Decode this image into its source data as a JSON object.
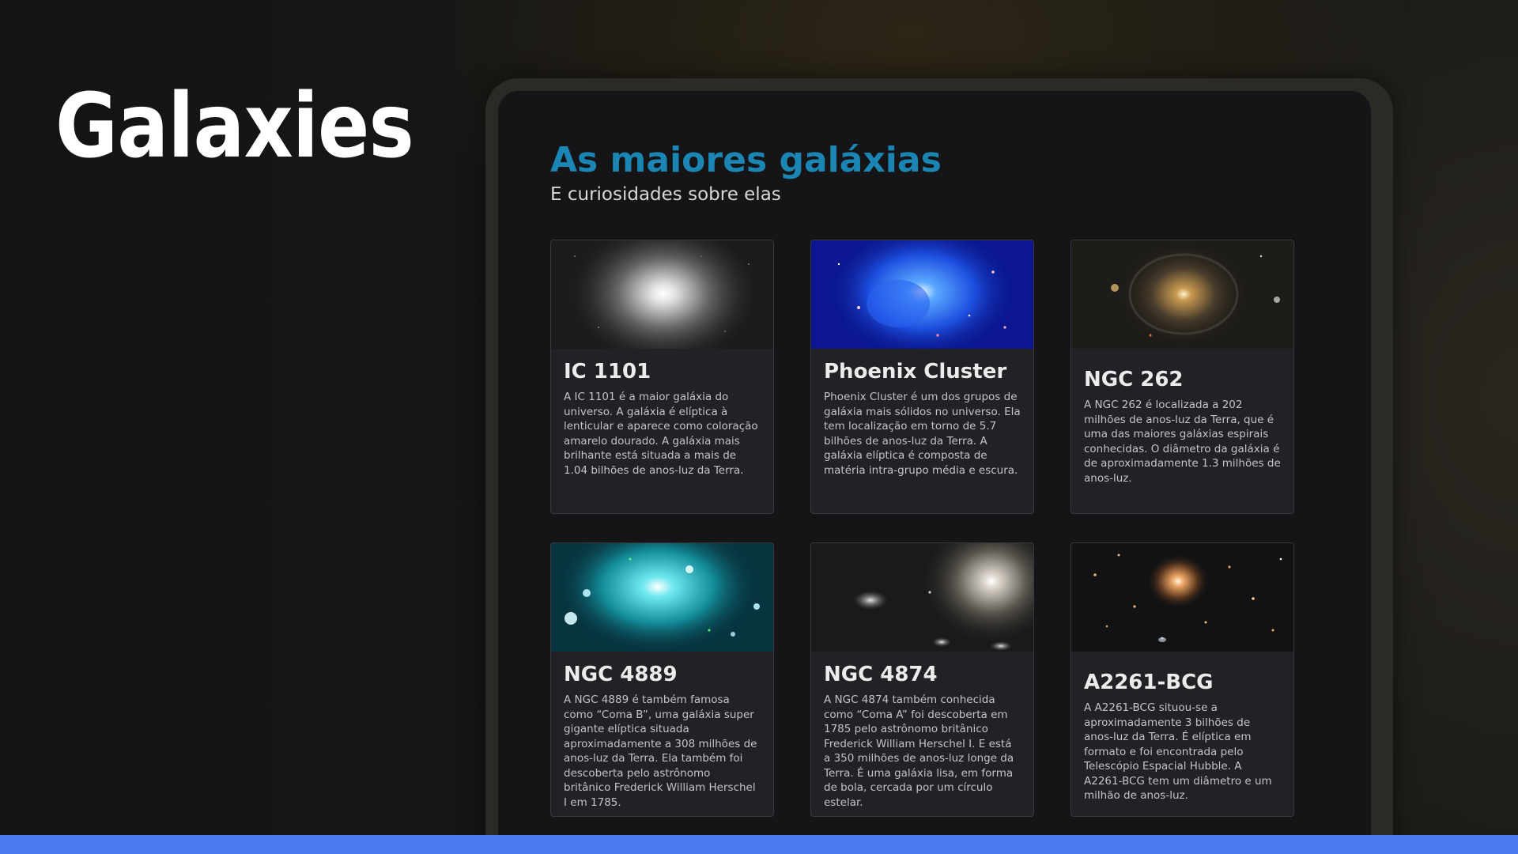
{
  "slide_title": "Galaxies",
  "app": {
    "heading": "As maiores galáxias",
    "subheading": "E curiosidades sobre elas"
  },
  "cards": [
    {
      "title": "IC 1101",
      "description": "A IC 1101 é a maior galáxia do universo. A galáxia é elíptica à lenticular e aparece como coloração amarelo dourado. A galáxia mais brilhante está situada a mais de 1.04 bilhões de anos-luz da Terra.",
      "image": "elliptical-galaxy-grey"
    },
    {
      "title": "Phoenix Cluster",
      "description": "Phoenix Cluster é um dos grupos de galáxia mais sólidos no universo. Ela tem localização em torno de 5.7 bilhões de anos-luz da Terra. A galáxia elíptica é composta de matéria intra-grupo média e escura.",
      "image": "galaxy-cluster-blue"
    },
    {
      "title": "NGC 262",
      "description": "A NGC 262 é localizada a 202 milhões de anos-luz da Terra, que é uma das maiores galáxias espirais conhecidas. O diâmetro da galáxia é de aproximadamente 1.3 milhões de anos-luz.",
      "image": "spiral-galaxy-gold"
    },
    {
      "title": "NGC 4889",
      "description": "A NGC 4889 é também famosa como “Coma B”, uma galáxia super gigante elíptica situada aproximadamente a 308 milhões de anos-luz da Terra. Ela também foi descoberta pelo astrônomo britânico Frederick William Herschel I em 1785.",
      "image": "galaxy-cluster-cyan"
    },
    {
      "title": "NGC 4874",
      "description": "A NGC 4874 também conhecida como “Coma A” foi descoberta em 1785 pelo astrônomo britânico Frederick William Herschel I. E está a 350 milhões de anos-luz longe da Terra. É uma galáxia lisa, em forma de bola, cercada por um círculo estelar.",
      "image": "elliptical-galaxy-pair"
    },
    {
      "title": "A2261-BCG",
      "description": "A A2261-BCG situou-se a aproximadamente 3 bilhões de anos-luz da Terra. É elíptica em formato e foi encontrada pelo Telescópio Espacial Hubble. A A2261-BCG tem um diâmetro e um milhão de anos-luz.",
      "image": "galaxy-field-orange"
    }
  ],
  "colors": {
    "heading_accent": "#1b86b3",
    "bottom_bar": "#4a7cf0",
    "card_background": "#222226"
  }
}
